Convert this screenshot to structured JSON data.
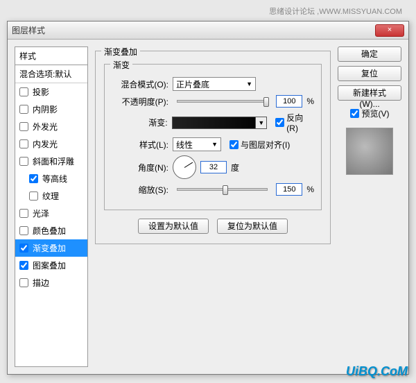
{
  "watermark_top": "思绪设计论坛 ,WWW.MISSYUAN.COM",
  "watermark_bottom": "UiBQ.CoM",
  "dialog": {
    "title": "图层样式",
    "close": "×"
  },
  "styles_panel": {
    "header": "样式",
    "sub": "混合选项:默认",
    "items": [
      {
        "label": "投影",
        "checked": false,
        "selected": false
      },
      {
        "label": "内阴影",
        "checked": false,
        "selected": false
      },
      {
        "label": "外发光",
        "checked": false,
        "selected": false
      },
      {
        "label": "内发光",
        "checked": false,
        "selected": false
      },
      {
        "label": "斜面和浮雕",
        "checked": false,
        "selected": false
      },
      {
        "label": "等高线",
        "checked": true,
        "selected": false,
        "indent": true
      },
      {
        "label": "纹理",
        "checked": false,
        "selected": false,
        "indent": true
      },
      {
        "label": "光泽",
        "checked": false,
        "selected": false
      },
      {
        "label": "颜色叠加",
        "checked": false,
        "selected": false
      },
      {
        "label": "渐变叠加",
        "checked": true,
        "selected": true
      },
      {
        "label": "图案叠加",
        "checked": true,
        "selected": false
      },
      {
        "label": "描边",
        "checked": false,
        "selected": false
      }
    ]
  },
  "main": {
    "section_title": "渐变叠加",
    "group_title": "渐变",
    "blend_mode": {
      "label": "混合模式(O):",
      "value": "正片叠底"
    },
    "opacity": {
      "label": "不透明度(P):",
      "value": "100",
      "unit": "%",
      "thumb_pct": 96
    },
    "gradient": {
      "label": "渐变:",
      "reverse_label": "反向(R)",
      "reverse_checked": true
    },
    "style": {
      "label": "样式(L):",
      "value": "线性",
      "align_label": "与图层对齐(I)",
      "align_checked": true
    },
    "angle": {
      "label": "角度(N):",
      "value": "32",
      "unit": "度"
    },
    "scale": {
      "label": "缩放(S):",
      "value": "150",
      "unit": "%",
      "thumb_pct": 50
    },
    "reset_btn": "设置为默认值",
    "restore_btn": "复位为默认值"
  },
  "right": {
    "ok": "确定",
    "cancel": "复位",
    "new_style": "新建样式(W)...",
    "preview_label": "预览(V)",
    "preview_checked": true
  }
}
